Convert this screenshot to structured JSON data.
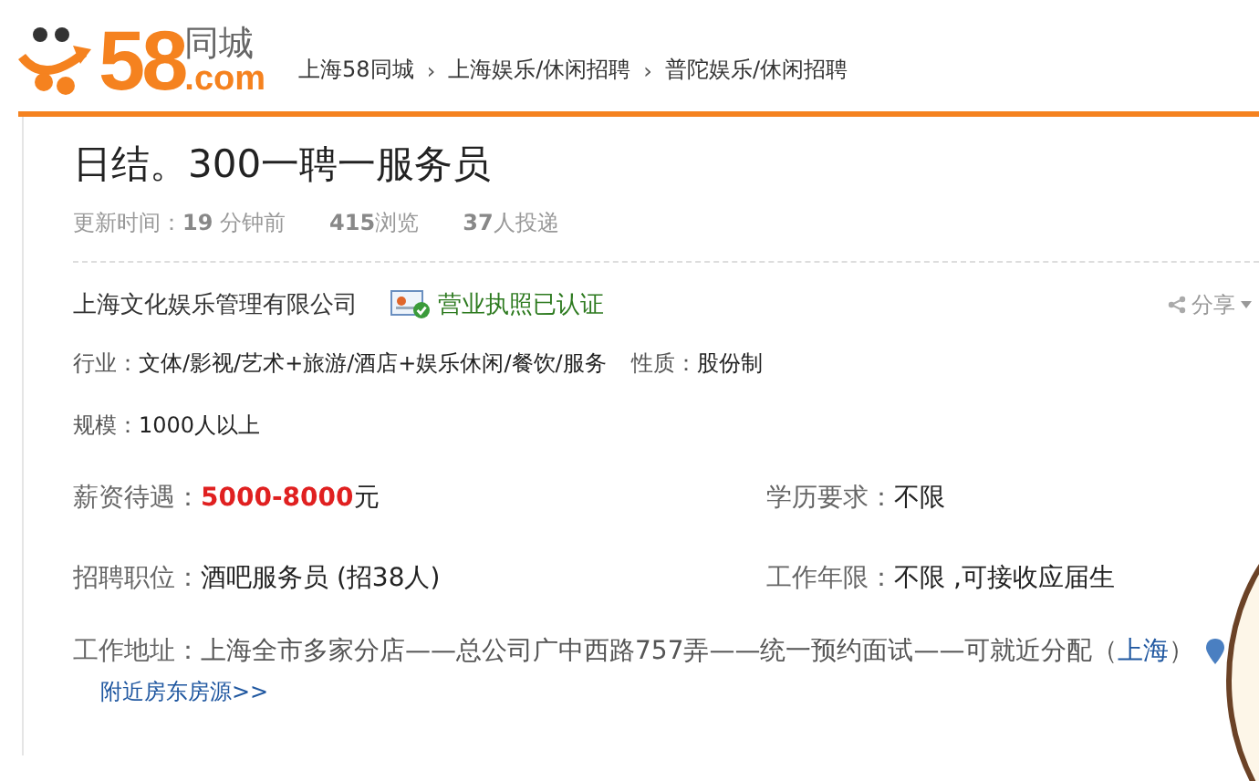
{
  "logo": {
    "number": "58",
    "cn": "同城",
    "domain": ".com"
  },
  "breadcrumb": [
    {
      "label": "上海58同城"
    },
    {
      "label": "上海娱乐/休闲招聘"
    },
    {
      "label": "普陀娱乐/休闲招聘"
    }
  ],
  "breadcrumb_separator": "›",
  "title": "日结。300一聘一服务员",
  "meta": {
    "updated_label": "更新时间：",
    "updated_value": "19",
    "updated_unit": "分钟前",
    "views_value": "415",
    "views_unit": "浏览",
    "applicants_value": "37",
    "applicants_unit": "人投递"
  },
  "company": {
    "name": "上海文化娱乐管理有限公司",
    "verified": true,
    "verified_label": "营业执照已认证",
    "share": "分享"
  },
  "company_info": [
    [
      {
        "label": "行业：",
        "value": "文体/影视/艺术+旅游/酒店+娱乐休闲/餐饮/服务"
      },
      {
        "label": "性质：",
        "value": "股份制"
      }
    ],
    [
      {
        "label": "规模：",
        "value": "1000人以上"
      }
    ]
  ],
  "job_info": [
    [
      {
        "label": "薪资待遇：",
        "value": "5000-8000",
        "suffix": "元",
        "kind": "salary"
      },
      {
        "label": "学历要求：",
        "value": "不限",
        "kind": "plain"
      }
    ],
    [
      {
        "label": "招聘职位：",
        "value": "酒吧服务员 (招38人)",
        "kind": "plain"
      },
      {
        "label": "工作年限：",
        "value": "不限 ,可接收应届生",
        "kind": "plain"
      }
    ]
  ],
  "address": {
    "label": "工作地址：",
    "value": "上海全市多家分店——总公司广中西路757弄——统一预约面试——可就近分配",
    "open": "（",
    "city": "上海",
    "close": "）",
    "nearby_link": "附近房东房源>>"
  }
}
